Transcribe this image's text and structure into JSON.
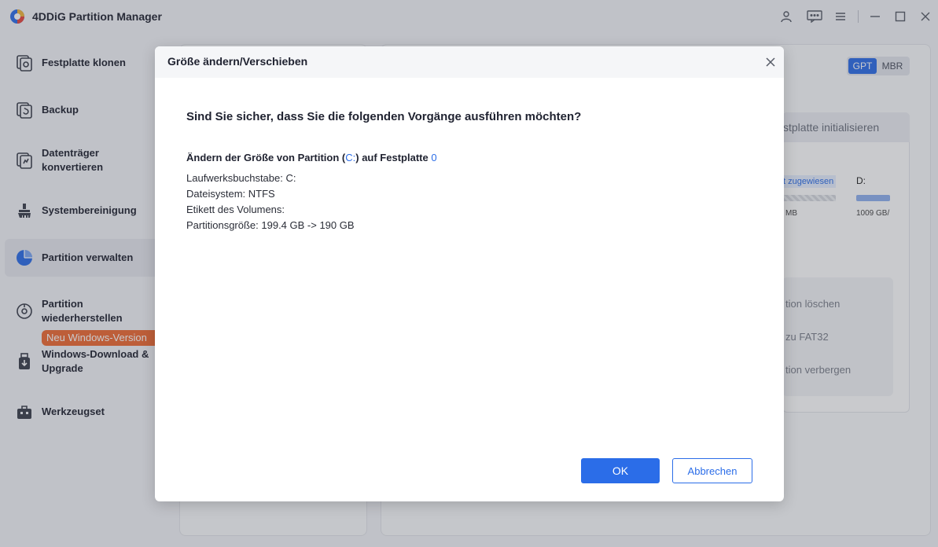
{
  "app": {
    "title": "4DDiG Partition Manager"
  },
  "sidebar": {
    "items": [
      {
        "label": "Festplatte klonen"
      },
      {
        "label": "Backup"
      },
      {
        "label": "Datenträger konvertieren"
      },
      {
        "label": "Systembereinigung"
      },
      {
        "label": "Partition verwalten"
      },
      {
        "label": "Partition wiederherstellen"
      },
      {
        "label": "Windows-Download & Upgrade"
      },
      {
        "label": "Werkzeugset"
      }
    ],
    "active_item": "Partition verwalten",
    "new_badge": "Neu Windows-Version"
  },
  "background": {
    "partition_style": {
      "gpt": "GPT",
      "mbr": "MBR",
      "selected": "GPT"
    },
    "tab_text": "stplatte initialisieren",
    "unassigned_label": "t zugewiesen",
    "unassigned_size": "MB",
    "drive_letter": "D:",
    "drive_size": "1009 GB/",
    "actions": [
      "tion löschen",
      "zu FAT32",
      "tion verbergen"
    ]
  },
  "dialog": {
    "title": "Größe ändern/Verschieben",
    "question": "Sind Sie sicher, dass Sie die folgenden Vorgänge ausführen möchten?",
    "operation": {
      "prefix": "Ändern der Größe von Partition (",
      "partition": "C:",
      "middle": ") auf Festplatte ",
      "disk": "0"
    },
    "details": [
      "Laufwerksbuchstabe: C:",
      "Dateisystem: NTFS",
      "Etikett des Volumens:",
      "Partitionsgröße: 199.4 GB -> 190 GB"
    ],
    "ok_label": "OK",
    "cancel_label": "Abbrechen"
  },
  "colors": {
    "accent": "#2b6de8",
    "badge": "#ef6a33"
  }
}
